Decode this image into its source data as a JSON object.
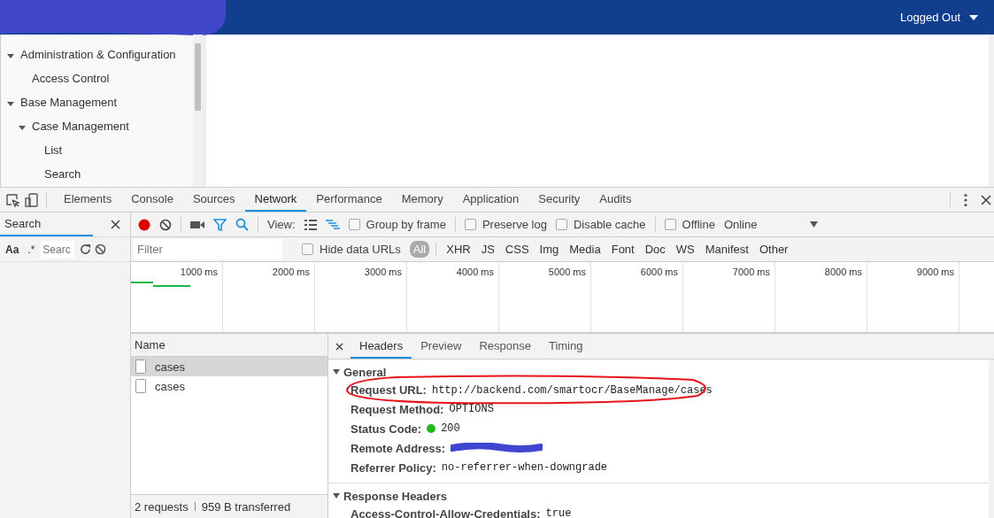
{
  "header": {
    "user": "Logged Out"
  },
  "sidebar": {
    "tree": [
      {
        "label": "Administration & Configuration",
        "expanded": true,
        "children": [
          {
            "label": "Access Control"
          }
        ]
      },
      {
        "label": "Base Management",
        "expanded": true,
        "children": [
          {
            "label": "Case Management",
            "expanded": true,
            "children": [
              {
                "label": "List"
              },
              {
                "label": "Search"
              }
            ]
          }
        ]
      }
    ]
  },
  "devtools": {
    "tabs": [
      {
        "label": "Elements",
        "selected": false
      },
      {
        "label": "Console",
        "selected": false
      },
      {
        "label": "Sources",
        "selected": false
      },
      {
        "label": "Network",
        "selected": true
      },
      {
        "label": "Performance",
        "selected": false
      },
      {
        "label": "Memory",
        "selected": false
      },
      {
        "label": "Application",
        "selected": false
      },
      {
        "label": "Security",
        "selected": false
      },
      {
        "label": "Audits",
        "selected": false
      }
    ],
    "search_pane": {
      "placeholder": "Search",
      "case_toggle": "Aa",
      "regex_toggle": ".*",
      "query_placeholder": "Searc"
    },
    "toolbar": {
      "recording": true,
      "view_label": "View:",
      "checkboxes": [
        {
          "label": "Group by frame",
          "checked": false
        },
        {
          "label": "Preserve log",
          "checked": false
        },
        {
          "label": "Disable cache",
          "checked": false
        },
        {
          "label": "Offline",
          "checked": false
        }
      ],
      "throttle": "Online"
    },
    "filter": {
      "placeholder": "Filter",
      "hide_data_urls": {
        "label": "Hide data URLs",
        "checked": false
      },
      "types": [
        {
          "label": "All",
          "selected": true
        },
        {
          "label": "XHR",
          "selected": false
        },
        {
          "label": "JS",
          "selected": false
        },
        {
          "label": "CSS",
          "selected": false
        },
        {
          "label": "Img",
          "selected": false
        },
        {
          "label": "Media",
          "selected": false
        },
        {
          "label": "Font",
          "selected": false
        },
        {
          "label": "Doc",
          "selected": false
        },
        {
          "label": "WS",
          "selected": false
        },
        {
          "label": "Manifest",
          "selected": false
        },
        {
          "label": "Other",
          "selected": false
        }
      ]
    },
    "timeline": {
      "ticks": [
        "1000 ms",
        "2000 ms",
        "3000 ms",
        "4000 ms",
        "5000 ms",
        "6000 ms",
        "7000 ms",
        "8000 ms",
        "9000 ms"
      ]
    },
    "requests": {
      "column": "Name",
      "rows": [
        {
          "name": "cases",
          "selected": true
        },
        {
          "name": "cases",
          "selected": false
        }
      ],
      "count": "2 requests",
      "transferred": "959 B transferred"
    },
    "details": {
      "tabs": [
        {
          "label": "Headers",
          "selected": true
        },
        {
          "label": "Preview",
          "selected": false
        },
        {
          "label": "Response",
          "selected": false
        },
        {
          "label": "Timing",
          "selected": false
        }
      ],
      "sections": [
        {
          "title": "General",
          "expanded": true,
          "rows": [
            {
              "label": "Request URL:",
              "value": "http://backend.com/smartocr/BaseManage/cases",
              "kind": "circled"
            },
            {
              "label": "Request Method:",
              "value": "OPTIONS",
              "kind": "plain"
            },
            {
              "label": "Status Code:",
              "value": "200",
              "kind": "status",
              "color": "#1fb81f"
            },
            {
              "label": "Remote Address:",
              "kind": "redacted"
            },
            {
              "label": "Referrer Policy:",
              "value": "no-referrer-when-downgrade",
              "kind": "plain"
            }
          ]
        },
        {
          "title": "Response Headers",
          "expanded": true,
          "rows": [
            {
              "label": "Access-Control-Allow-Credentials:",
              "value": "true",
              "kind": "plain"
            }
          ]
        }
      ]
    }
  }
}
